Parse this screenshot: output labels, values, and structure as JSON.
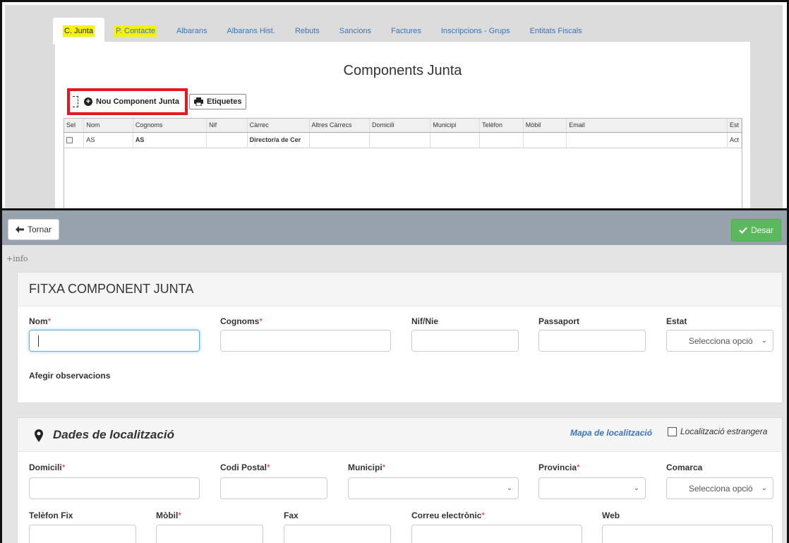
{
  "tabs": [
    {
      "label": "C. Junta",
      "active": true,
      "highlighted": true
    },
    {
      "label": "P. Contacte",
      "active": false,
      "highlighted": true
    },
    {
      "label": "Albarans"
    },
    {
      "label": "Albarans Hist."
    },
    {
      "label": "Rebuts"
    },
    {
      "label": "Sancions"
    },
    {
      "label": "Factures"
    },
    {
      "label": "Inscripcions - Grups"
    },
    {
      "label": "Entitats Fiscals"
    }
  ],
  "panel": {
    "title": "Components Junta",
    "new_button": "Nou Component Junta",
    "labels_button": "Etiquetes"
  },
  "grid": {
    "columns": [
      "Sel",
      "Nom",
      "Cognoms",
      "Nif",
      "Càrrec",
      "Altres Càrrecs",
      "Domicili",
      "Municipi",
      "Telèfon",
      "Mòbil",
      "Email",
      "Est"
    ],
    "rows": [
      {
        "nom": "AS",
        "cognoms": "AS",
        "nif": "",
        "carrec": "Director/a de Cer",
        "altres": "",
        "domicili": "",
        "municipi": "",
        "telefon": "",
        "mobil": "",
        "email": "",
        "estat": "Act"
      }
    ]
  },
  "topbar": {
    "back_label": "Tornar",
    "save_label": "Desar"
  },
  "info_label": "+info",
  "fitxa": {
    "title": "FITXA COMPONENT JUNTA",
    "nom": "Nom",
    "cognoms": "Cognoms",
    "nif": "Nif/Nie",
    "passaport": "Passaport",
    "estat": "Estat",
    "estat_select": "Selecciona opció",
    "observacions": "Afegir observacions"
  },
  "localitzacio": {
    "title": "Dades de localització",
    "map_link": "Mapa de localització",
    "foreign_label": "Localització estrangera",
    "domicili": "Domicili",
    "codi_postal": "Codi Postal",
    "municipi": "Municipi",
    "provincia": "Provincia",
    "comarca": "Comarca",
    "comarca_select": "Selecciona opció",
    "telefon_fix": "Telèfon Fix",
    "mobil": "Mòbil",
    "fax": "Fax",
    "correu": "Correu electrònic",
    "web": "Web"
  },
  "colors": {
    "highlight": "#f4f10a",
    "red_box": "#e3171d",
    "save_green": "#5cb85c",
    "topbar": "#98a2ad",
    "link_blue": "#3a73b8",
    "required": "#c9302c"
  }
}
